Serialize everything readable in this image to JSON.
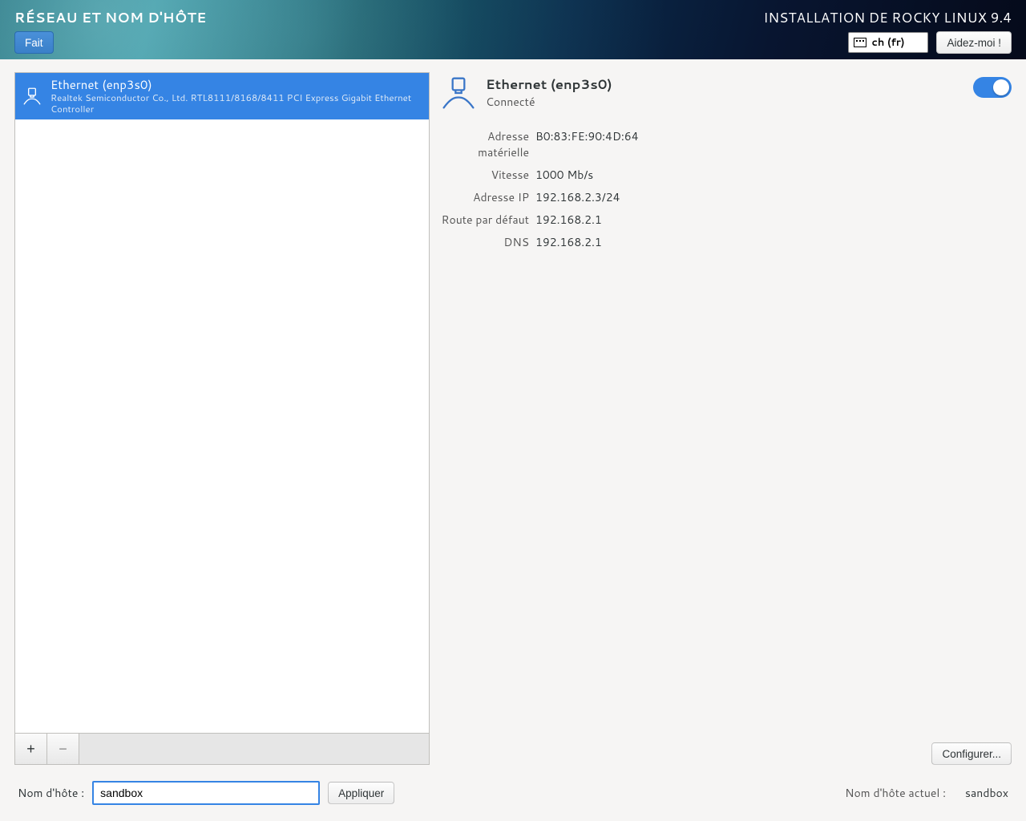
{
  "header": {
    "title_left": "RÉSEAU ET NOM D'HÔTE",
    "done_label": "Fait",
    "title_right": "INSTALLATION DE ROCKY LINUX 9.4",
    "keyboard_layout": "ch (fr)",
    "help_label": "Aidez-moi !"
  },
  "devices": [
    {
      "name": "Ethernet (enp3s0)",
      "subtitle": "Realtek Semiconductor Co., Ltd. RTL8111/8168/8411 PCI Express Gigabit Ethernet Controller"
    }
  ],
  "detail": {
    "title": "Ethernet (enp3s0)",
    "status": "Connecté",
    "rows": {
      "hw_label": "Adresse matérielle",
      "hw_value": "B0:83:FE:90:4D:64",
      "speed_label": "Vitesse",
      "speed_value": "1000 Mb/s",
      "ip_label": "Adresse IP",
      "ip_value": "192.168.2.3/24",
      "route_label": "Route par défaut",
      "route_value": "192.168.2.1",
      "dns_label": "DNS",
      "dns_value": "192.168.2.1"
    },
    "configure_label": "Configurer...",
    "toggle_on": true
  },
  "buttons": {
    "add": "+",
    "remove": "−",
    "apply": "Appliquer"
  },
  "hostname": {
    "label": "Nom d'hôte :",
    "value": "sandbox",
    "current_label": "Nom d'hôte actuel :",
    "current_value": "sandbox"
  }
}
